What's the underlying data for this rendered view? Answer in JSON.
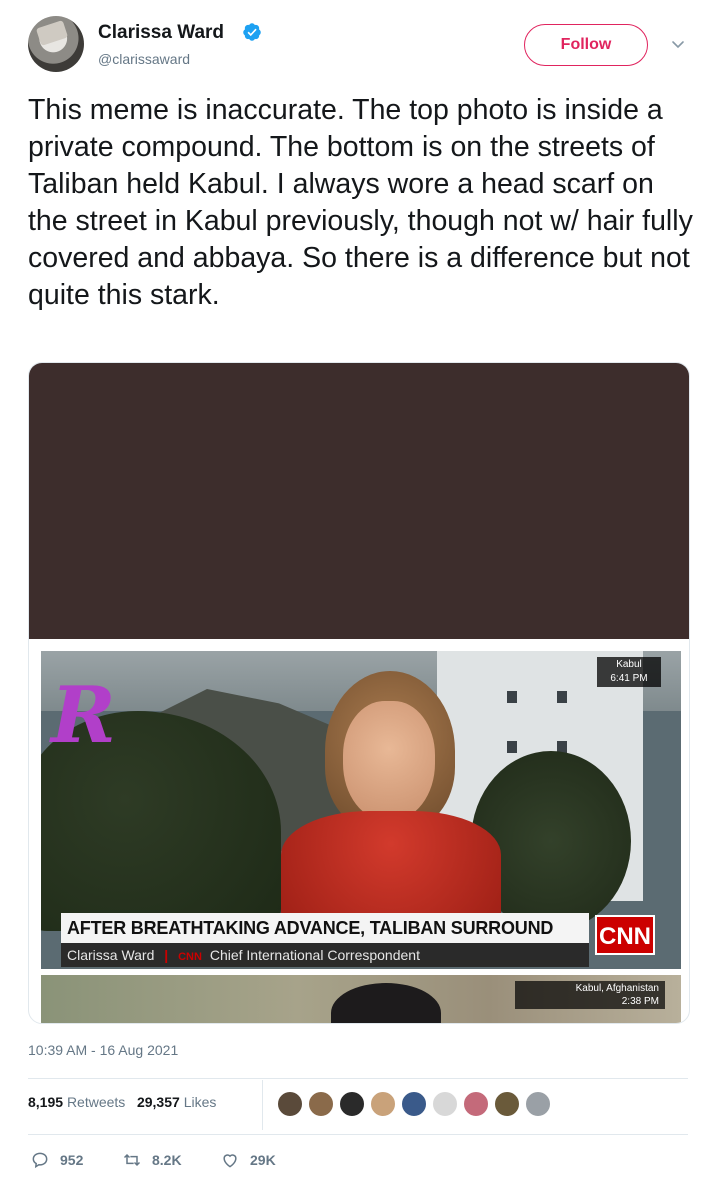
{
  "author": {
    "name": "Clarissa Ward",
    "handle": "@clarissaward",
    "verified": true,
    "avatar_icon": "avatar-photo"
  },
  "follow": {
    "label": "Follow",
    "color": "#e0245e"
  },
  "tweet": {
    "text": "This meme is inaccurate. The top photo is inside a private compound. The bottom is on the streets of Taliban held Kabul. I always wore a head scarf on the street in Kabul previously, though not w/ hair fully covered and abbaya. So there is a difference but not quite this stark."
  },
  "media": {
    "frame1": {
      "location": "Kabul",
      "time": "6:41 PM",
      "headline": "AFTER BREATHTAKING ADVANCE, TALIBAN SURROUND KABUL",
      "reporter": "Clarissa Ward",
      "network_tag": "CNN",
      "role": "Chief International Correspondent",
      "logo": "CNN",
      "overlay_logo": "R"
    },
    "frame2": {
      "location": "Kabul, Afghanistan",
      "time": "2:38 PM"
    }
  },
  "meta": {
    "timestamp": "10:39 AM - 16 Aug 2021"
  },
  "stats": {
    "retweets_count": "8,195",
    "retweets_label": "Retweets",
    "likes_count": "29,357",
    "likes_label": "Likes",
    "liker_colors": [
      "#5a4a3a",
      "#8a6a4a",
      "#2a2a2a",
      "#c9a27a",
      "#3a5a8a",
      "#d8d8d8",
      "#c46a7a",
      "#6a5a3a",
      "#9aa0a6"
    ]
  },
  "actions": {
    "replies": "952",
    "retweets": "8.2K",
    "likes": "29K"
  }
}
